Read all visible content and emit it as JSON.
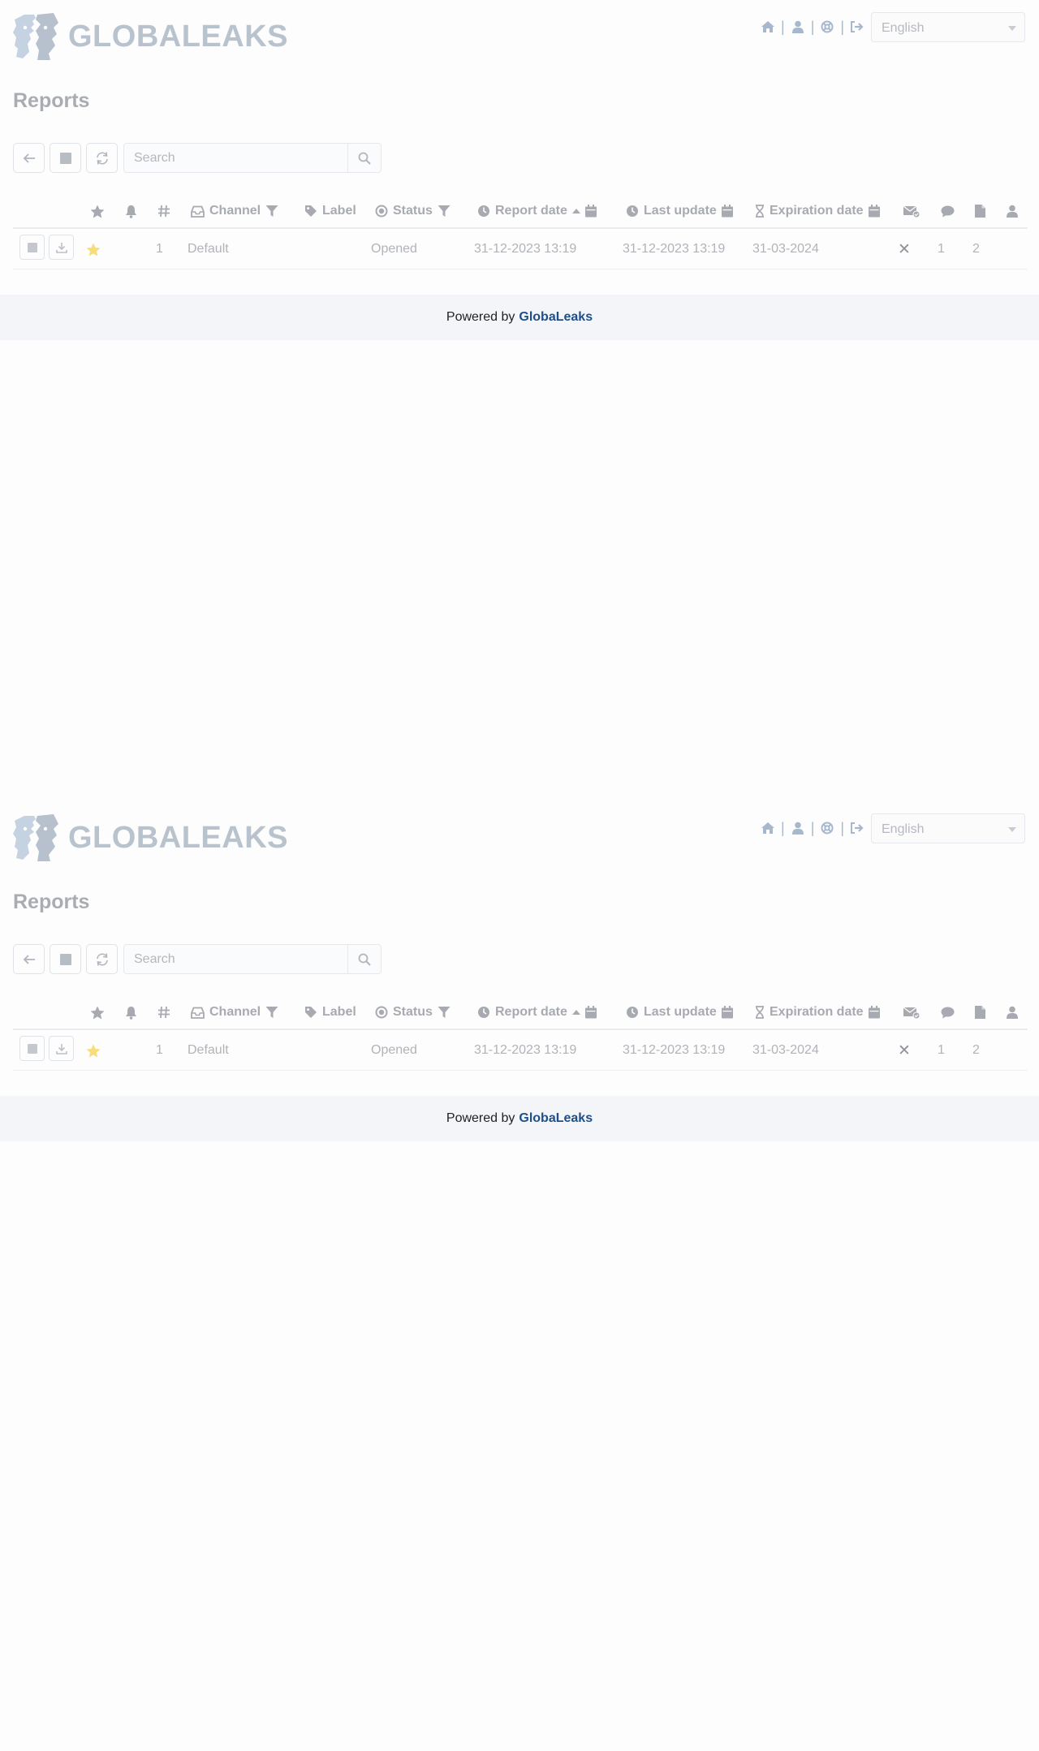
{
  "header": {
    "brand": "GLOBALEAKS",
    "nav_icons": [
      "home-icon",
      "user-icon",
      "support-icon",
      "logout-icon"
    ],
    "language": "English"
  },
  "page": {
    "title": "Reports"
  },
  "toolbar": {
    "buttons": [
      "back-arrow-icon",
      "select-all-icon",
      "refresh-icon"
    ],
    "search_placeholder": "Search"
  },
  "table": {
    "columns": {
      "channel": "Channel",
      "label": "Label",
      "status": "Status",
      "report_date": "Report date",
      "last_update": "Last update",
      "expiration_date": "Expiration date"
    },
    "rows": [
      {
        "id": "1",
        "channel": "Default",
        "label": "",
        "status": "Opened",
        "report_date": "31-12-2023 13:19",
        "last_update": "31-12-2023 13:19",
        "expiration_date": "31-03-2024",
        "notification_mark": "✕",
        "comments": "1",
        "files": "2"
      }
    ]
  },
  "footer": {
    "powered_by": "Powered by",
    "link": "GlobaLeaks"
  },
  "colors": {
    "accent": "#1e4f8a",
    "icon": "#a7b8cc",
    "star": "#f6de7a"
  }
}
